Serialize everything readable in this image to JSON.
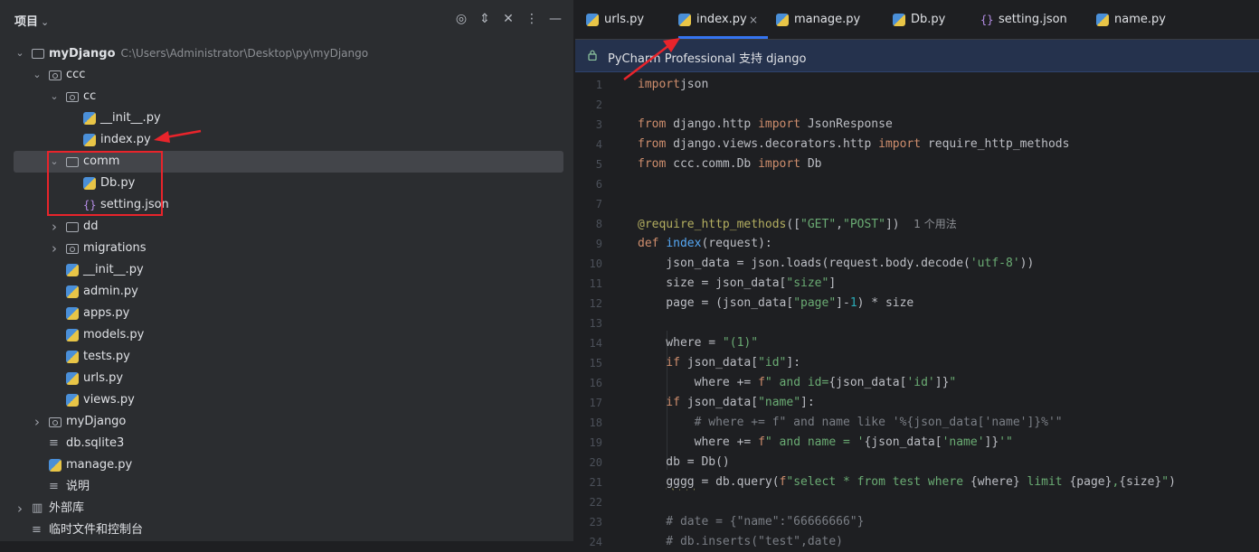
{
  "project_panel": {
    "title": "项目",
    "tree": [
      {
        "label": "myDjango",
        "path": "C:\\Users\\Administrator\\Desktop\\py\\myDjango",
        "arrow": "open",
        "icon": "folder",
        "indent": 0,
        "bold": true
      },
      {
        "label": "ccc",
        "arrow": "open",
        "icon": "package-folder",
        "indent": 1
      },
      {
        "label": "cc",
        "arrow": "open",
        "icon": "package-folder",
        "indent": 2
      },
      {
        "label": "__init__.py",
        "arrow": "",
        "icon": "python",
        "indent": 3
      },
      {
        "label": "index.py",
        "arrow": "",
        "icon": "python",
        "indent": 3
      },
      {
        "label": "comm",
        "arrow": "open",
        "icon": "folder",
        "indent": 2,
        "selected": true
      },
      {
        "label": "Db.py",
        "arrow": "",
        "icon": "python",
        "indent": 3
      },
      {
        "label": "setting.json",
        "arrow": "",
        "icon": "json",
        "indent": 3
      },
      {
        "label": "dd",
        "arrow": "closed",
        "icon": "folder",
        "indent": 2
      },
      {
        "label": "migrations",
        "arrow": "closed",
        "icon": "package-folder",
        "indent": 2
      },
      {
        "label": "__init__.py",
        "arrow": "",
        "icon": "python",
        "indent": 2
      },
      {
        "label": "admin.py",
        "arrow": "",
        "icon": "python",
        "indent": 2
      },
      {
        "label": "apps.py",
        "arrow": "",
        "icon": "python",
        "indent": 2
      },
      {
        "label": "models.py",
        "arrow": "",
        "icon": "python",
        "indent": 2
      },
      {
        "label": "tests.py",
        "arrow": "",
        "icon": "python",
        "indent": 2
      },
      {
        "label": "urls.py",
        "arrow": "",
        "icon": "python",
        "indent": 2
      },
      {
        "label": "views.py",
        "arrow": "",
        "icon": "python",
        "indent": 2
      },
      {
        "label": "myDjango",
        "arrow": "closed",
        "icon": "package-folder",
        "indent": 1
      },
      {
        "label": "db.sqlite3",
        "arrow": "",
        "icon": "text-file",
        "indent": 1
      },
      {
        "label": "manage.py",
        "arrow": "",
        "icon": "python",
        "indent": 1
      },
      {
        "label": "说明",
        "arrow": "",
        "icon": "text-file",
        "indent": 1
      },
      {
        "label": "外部库",
        "arrow": "closed",
        "icon": "library",
        "indent": 0
      },
      {
        "label": "临时文件和控制台",
        "arrow": "",
        "icon": "scratches",
        "indent": 0
      }
    ]
  },
  "tabs": [
    {
      "label": "urls.py",
      "icon": "python"
    },
    {
      "label": "index.py",
      "icon": "python",
      "active": true
    },
    {
      "label": "manage.py",
      "icon": "python"
    },
    {
      "label": "Db.py",
      "icon": "python"
    },
    {
      "label": "setting.json",
      "icon": "json"
    },
    {
      "label": "name.py",
      "icon": "python"
    }
  ],
  "banner": {
    "text": "PyCharm Professional 支持 django"
  },
  "editor": {
    "lines": [
      {
        "n": "1",
        "tokens": [
          [
            "kw",
            "import"
          ],
          [
            "",
            "json"
          ]
        ]
      },
      {
        "n": "2",
        "tokens": []
      },
      {
        "n": "3",
        "tokens": [
          [
            "kw",
            "from"
          ],
          [
            "",
            " django.http "
          ],
          [
            "kw",
            "import"
          ],
          [
            "",
            " JsonResponse"
          ]
        ]
      },
      {
        "n": "4",
        "tokens": [
          [
            "kw",
            "from"
          ],
          [
            "",
            " django.views.decorators.http "
          ],
          [
            "kw",
            "import"
          ],
          [
            "",
            " require_http_methods"
          ]
        ]
      },
      {
        "n": "5",
        "tokens": [
          [
            "kw",
            "from"
          ],
          [
            "",
            " ccc.comm.Db "
          ],
          [
            "kw",
            "import"
          ],
          [
            "",
            " Db"
          ]
        ]
      },
      {
        "n": "6",
        "tokens": []
      },
      {
        "n": "7",
        "tokens": []
      },
      {
        "n": "8",
        "tokens": [
          [
            "dec",
            "@require_http_methods"
          ],
          [
            "",
            "(["
          ],
          [
            "str",
            "\"GET\""
          ],
          [
            "",
            ","
          ],
          [
            "str",
            "\"POST\""
          ],
          [
            "",
            "])  "
          ],
          [
            "hint",
            "1 个用法"
          ]
        ]
      },
      {
        "n": "9",
        "tokens": [
          [
            "kw",
            "def"
          ],
          [
            "",
            " "
          ],
          [
            "fn",
            "index"
          ],
          [
            "",
            "(request):"
          ]
        ]
      },
      {
        "n": "10",
        "tokens": [
          [
            "",
            "    json_data = json.loads(request.body.decode("
          ],
          [
            "str",
            "'utf-8'"
          ],
          [
            "",
            "))"
          ]
        ]
      },
      {
        "n": "11",
        "tokens": [
          [
            "",
            "    size = json_data["
          ],
          [
            "str",
            "\"size\""
          ],
          [
            "",
            "]"
          ]
        ]
      },
      {
        "n": "12",
        "tokens": [
          [
            "",
            "    page = (json_data["
          ],
          [
            "str",
            "\"page\""
          ],
          [
            "",
            "]-"
          ],
          [
            "num",
            "1"
          ],
          [
            "",
            ") * size"
          ]
        ]
      },
      {
        "n": "13",
        "tokens": []
      },
      {
        "n": "14",
        "tokens": [
          [
            "",
            "    where = "
          ],
          [
            "str",
            "\"(1)\""
          ]
        ]
      },
      {
        "n": "15",
        "tokens": [
          [
            "kw",
            "    if"
          ],
          [
            "",
            " json_data["
          ],
          [
            "str",
            "\"id\""
          ],
          [
            "",
            "]:"
          ]
        ]
      },
      {
        "n": "16",
        "tokens": [
          [
            "",
            "        where += "
          ],
          [
            "kw",
            "f"
          ],
          [
            "str",
            "\" and id="
          ],
          [
            "",
            "{json_data["
          ],
          [
            "str",
            "'id'"
          ],
          [
            "",
            "]}"
          ],
          [
            "str",
            "\""
          ]
        ]
      },
      {
        "n": "17",
        "tokens": [
          [
            "kw",
            "    if"
          ],
          [
            "",
            " json_data["
          ],
          [
            "str",
            "\"name\""
          ],
          [
            "",
            "]:"
          ]
        ]
      },
      {
        "n": "18",
        "tokens": [
          [
            "cmt",
            "        # where += f\" and name like '%{json_data['name']}%'\""
          ]
        ]
      },
      {
        "n": "19",
        "tokens": [
          [
            "",
            "        where += "
          ],
          [
            "kw",
            "f"
          ],
          [
            "str",
            "\" and name = '"
          ],
          [
            "",
            "{json_data["
          ],
          [
            "str",
            "'name'"
          ],
          [
            "",
            "]}"
          ],
          [
            "str",
            "'\""
          ]
        ]
      },
      {
        "n": "20",
        "tokens": [
          [
            "",
            "    db = Db()"
          ]
        ]
      },
      {
        "n": "21",
        "tokens": [
          [
            "",
            "    "
          ],
          [
            "uwarn",
            "gggg"
          ],
          [
            "",
            " = db.query("
          ],
          [
            "kw",
            "f"
          ],
          [
            "str",
            "\"select * from test where "
          ],
          [
            "",
            "{where}"
          ],
          [
            "str",
            " limit "
          ],
          [
            "",
            "{page}"
          ],
          [
            "str",
            ","
          ],
          [
            "",
            "{size}"
          ],
          [
            "str",
            "\""
          ],
          [
            "",
            ")"
          ]
        ]
      },
      {
        "n": "22",
        "tokens": []
      },
      {
        "n": "23",
        "tokens": [
          [
            "cmt",
            "    # date = {\"name\":\"66666666\"}"
          ]
        ]
      },
      {
        "n": "24",
        "tokens": [
          [
            "cmt",
            "    # db.inserts(\"test\",date)"
          ]
        ]
      }
    ]
  },
  "colors": {
    "accent": "#3574f0",
    "annotation": "#e8242b"
  }
}
